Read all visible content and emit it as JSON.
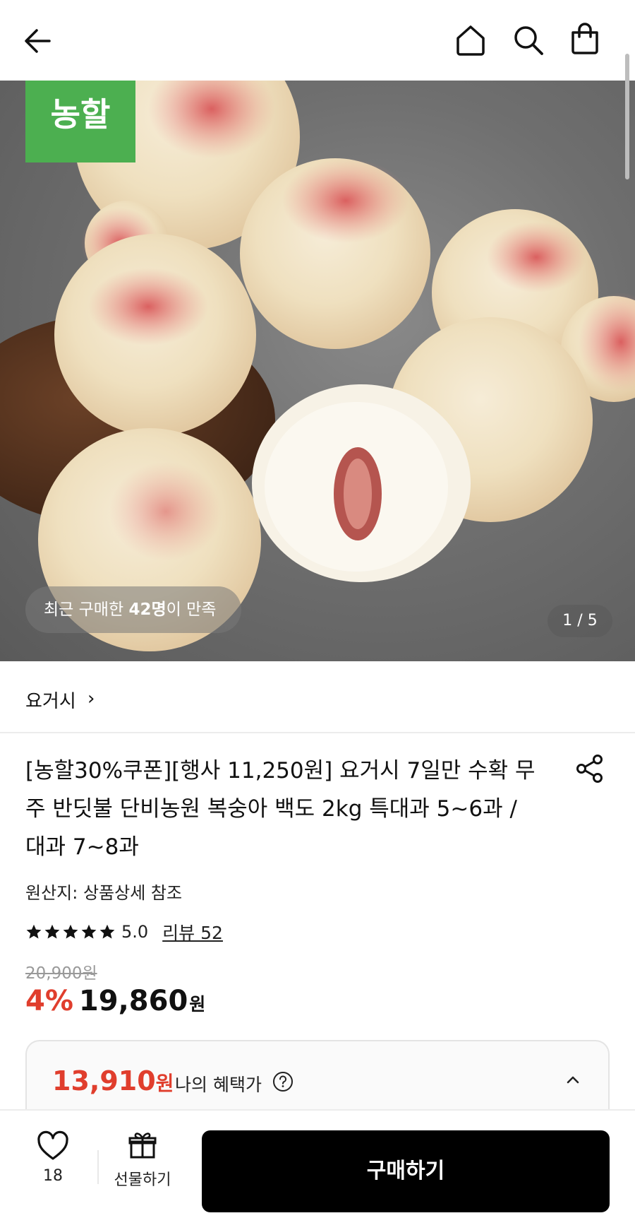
{
  "header": {
    "back_icon": "arrow-left-icon",
    "home_icon": "home-icon",
    "search_icon": "search-icon",
    "cart_icon": "shopping-bag-icon"
  },
  "hero": {
    "brand_badge": "농할",
    "review_prefix": "최근 구매한 ",
    "review_count": "42명",
    "review_suffix": "이 만족",
    "image_counter": "1 / 5"
  },
  "store": {
    "name": "요거시",
    "chevron": "›"
  },
  "product": {
    "title": "[농할30%쿠폰][행사 11,250원] 요거시 7일만 수확 무주 반딧불 단비농원 복숭아 백도 2kg 특대과 5~6과 / 대과 7~8과",
    "origin": "원산지: 상품상세 참조",
    "rating_value": 5.0,
    "rating_text": "5.0",
    "reviews_label": "리뷰 52",
    "original_price": "20,900원",
    "discount": "4%",
    "price": "19,860",
    "price_unit": "원"
  },
  "benefit": {
    "price": "13,910",
    "unit": "원",
    "label": "나의 혜택가"
  },
  "bottom": {
    "like_count": "18",
    "gift_label": "선물하기",
    "buy_label": "구매하기"
  },
  "colors": {
    "accent_red": "#e03e2d",
    "brand_green": "#4caf50",
    "buy_button": "#000000"
  }
}
